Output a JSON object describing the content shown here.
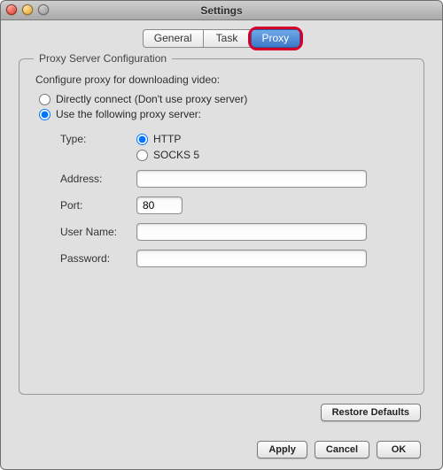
{
  "window": {
    "title": "Settings"
  },
  "tabs": {
    "general": "General",
    "task": "Task",
    "proxy": "Proxy",
    "active": "proxy"
  },
  "group": {
    "legend": "Proxy Server Configuration",
    "subtitle": "Configure proxy for downloading video:",
    "mode": {
      "direct_label": "Directly connect (Don't use proxy server)",
      "use_proxy_label": "Use the following proxy server:",
      "selected": "use_proxy"
    },
    "form": {
      "type_label": "Type:",
      "type_options": {
        "http": "HTTP",
        "socks5": "SOCKS 5",
        "selected": "http"
      },
      "address_label": "Address:",
      "address_value": "",
      "port_label": "Port:",
      "port_value": "80",
      "username_label": "User Name:",
      "username_value": "",
      "password_label": "Password:",
      "password_value": ""
    }
  },
  "buttons": {
    "restore": "Restore Defaults",
    "apply": "Apply",
    "cancel": "Cancel",
    "ok": "OK"
  }
}
